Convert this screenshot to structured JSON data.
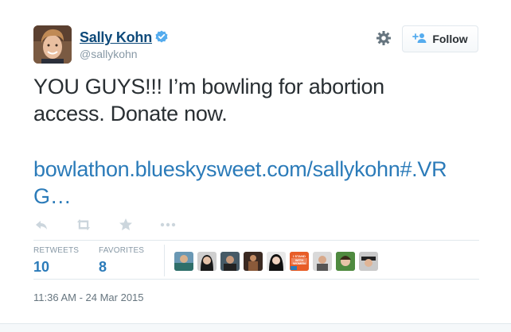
{
  "user": {
    "name": "Sally Kohn",
    "handle": "@sallykohn"
  },
  "follow": {
    "label": "Follow"
  },
  "tweet": {
    "text": "YOU GUYS!!!  I’m bowling for abortion\naccess.  Donate now.",
    "link": "bowlathon.blueskysweet.com/sallykohn#.VRG…"
  },
  "icons": {
    "actions": [
      "reply-icon",
      "retweet-icon",
      "favorite-icon",
      "more-icon"
    ],
    "verified": "verified-badge-icon",
    "settings": "gear-icon"
  },
  "stats": {
    "retweets_label": "RETWEETS",
    "retweets_value": "10",
    "favorites_label": "FAVORITES",
    "favorites_value": "8"
  },
  "favoriters": {
    "badge_text": "I STAND WITH WOMEN"
  },
  "timestamp": "11:36 AM - 24 Mar 2015",
  "colors": {
    "name": "#0e4a7a",
    "link": "#2b7bb9",
    "verified": "#55acee",
    "text": "#292f33",
    "muted": "#8899a6"
  }
}
